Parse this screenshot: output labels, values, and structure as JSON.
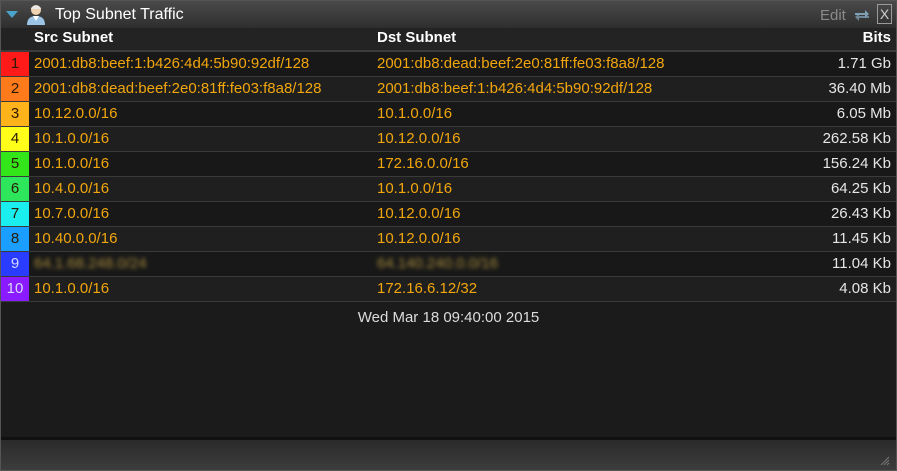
{
  "header": {
    "title": "Top Subnet Traffic",
    "edit_label": "Edit",
    "close_label": "X"
  },
  "columns": {
    "src": "Src Subnet",
    "dst": "Dst Subnet",
    "bits": "Bits"
  },
  "rows": [
    {
      "rank": "1",
      "color": "#ff1a1a",
      "src": "2001:db8:beef:1:b426:4d4:5b90:92df/128",
      "dst": "2001:db8:dead:beef:2e0:81ff:fe03:f8a8/128",
      "bits": "1.71 Gb"
    },
    {
      "rank": "2",
      "color": "#ff7a1a",
      "src": "2001:db8:dead:beef:2e0:81ff:fe03:f8a8/128",
      "dst": "2001:db8:beef:1:b426:4d4:5b90:92df/128",
      "bits": "36.40 Mb"
    },
    {
      "rank": "3",
      "color": "#ffb31a",
      "src": "10.12.0.0/16",
      "dst": "10.1.0.0/16",
      "bits": "6.05 Mb"
    },
    {
      "rank": "4",
      "color": "#ffff1a",
      "src": "10.1.0.0/16",
      "dst": "10.12.0.0/16",
      "bits": "262.58 Kb"
    },
    {
      "rank": "5",
      "color": "#33e61a",
      "src": "10.1.0.0/16",
      "dst": "172.16.0.0/16",
      "bits": "156.24 Kb"
    },
    {
      "rank": "6",
      "color": "#2ee65c",
      "src": "10.4.0.0/16",
      "dst": "10.1.0.0/16",
      "bits": "64.25 Kb"
    },
    {
      "rank": "7",
      "color": "#1aeeee",
      "src": "10.7.0.0/16",
      "dst": "10.12.0.0/16",
      "bits": "26.43 Kb"
    },
    {
      "rank": "8",
      "color": "#1a9eff",
      "src": "10.40.0.0/16",
      "dst": "10.12.0.0/16",
      "bits": "11.45 Kb"
    },
    {
      "rank": "9",
      "color": "#2a3cff",
      "src": "64.1.68.248.0/24",
      "dst": "64.140.240.0.0/16",
      "bits": "11.04 Kb",
      "redacted": true
    },
    {
      "rank": "10",
      "color": "#8a1aff",
      "src": "10.1.0.0/16",
      "dst": "172.16.6.12/32",
      "bits": "4.08 Kb"
    }
  ],
  "footer": {
    "timestamp": "Wed Mar 18 09:40:00 2015"
  },
  "icons": {
    "collapse": "collapse-triangle-icon",
    "user": "user-icon",
    "refresh": "refresh-arrows-icon",
    "grip": "resize-grip-icon"
  }
}
